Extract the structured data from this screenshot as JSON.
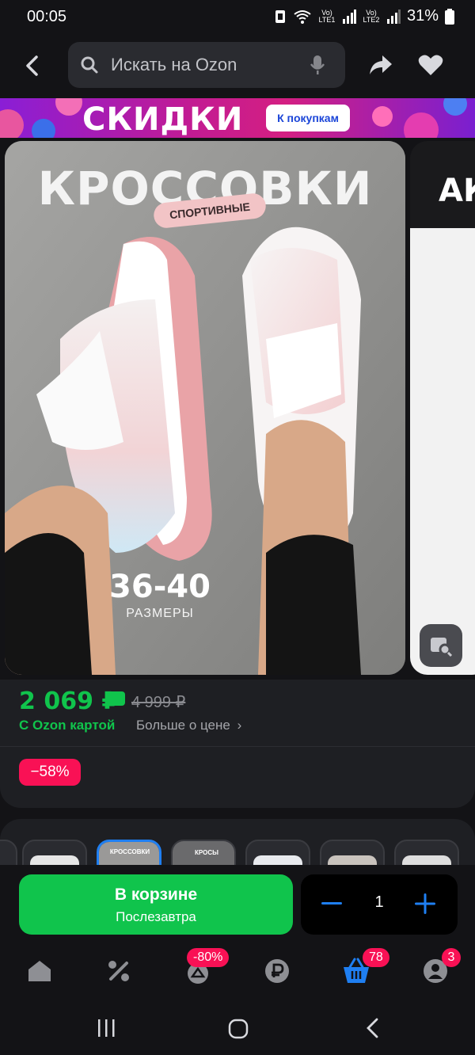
{
  "status": {
    "time": "00:05",
    "battery": "31%",
    "lte1": "Vo) LTE1",
    "lte2": "Vo) LTE2"
  },
  "search": {
    "placeholder": "Искать на Ozon"
  },
  "banner": {
    "title": "СКИДКИ",
    "cta": "К покупкам"
  },
  "gallery": {
    "title": "КРОССОВКИ",
    "badge": "СПОРТИВНЫЕ",
    "sizes": "36-40",
    "sizes_label": "РАЗМЕРЫ",
    "next_title": "АК"
  },
  "price": {
    "current": "2 069 ₽",
    "old": "4 999 ₽",
    "ozon_card": "С Ozon картой",
    "more": "Больше о цене",
    "discount": "−58%"
  },
  "variants": {
    "selected_label": "КРОССОВКИ",
    "other_label": "КРОСЫ"
  },
  "cart": {
    "label": "В корзине",
    "delivery": "Послезавтра",
    "quantity": "1"
  },
  "nav": {
    "sale_badge": "-80%",
    "cart_badge": "78",
    "profile_badge": "3"
  },
  "colors": {
    "green": "#10C44C",
    "blue": "#1F7FF2",
    "pink": "#F91155"
  }
}
